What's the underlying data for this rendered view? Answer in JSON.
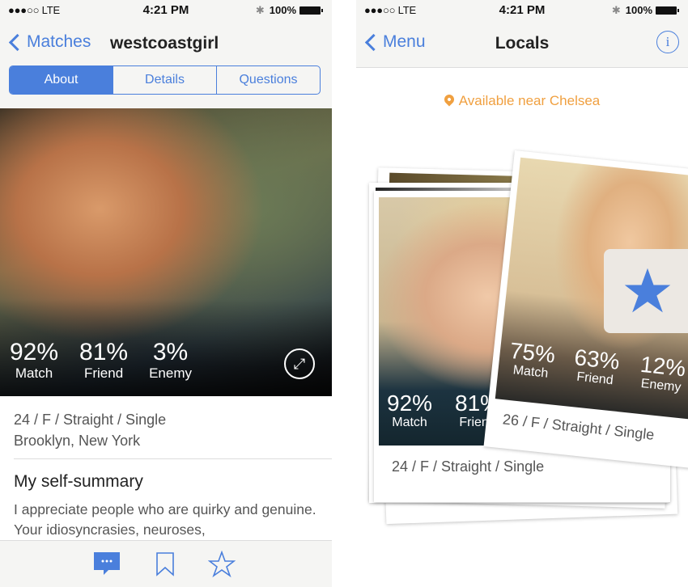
{
  "status_bar": {
    "signal": "●●●○○ LTE",
    "time": "4:21 PM",
    "battery": "100%"
  },
  "left_screen": {
    "nav": {
      "back_label": "Matches",
      "title": "westcoastgirl"
    },
    "segments": [
      {
        "label": "About",
        "active": true
      },
      {
        "label": "Details",
        "active": false
      },
      {
        "label": "Questions",
        "active": false
      }
    ],
    "stats": [
      {
        "value": "92%",
        "label": "Match"
      },
      {
        "value": "81%",
        "label": "Friend"
      },
      {
        "value": "3%",
        "label": "Enemy"
      }
    ],
    "profile_line": "24 / F / Straight / Single",
    "location": "Brooklyn, New York",
    "summary_title": "My self-summary",
    "summary_text": "I appreciate people who are quirky and genuine. Your idiosyncrasies, neuroses,",
    "tabbar": {
      "icons": [
        "message-icon",
        "bookmark-icon",
        "star-icon"
      ]
    }
  },
  "right_screen": {
    "nav": {
      "back_label": "Menu",
      "title": "Locals"
    },
    "location_text": "Available near Chelsea",
    "front_card": {
      "stats": [
        {
          "value": "92%",
          "label": "Match"
        },
        {
          "value": "81%",
          "label": "Friend"
        }
      ],
      "profile_line": "24 / F / Straight / Single"
    },
    "tilted_card": {
      "stats": [
        {
          "value": "75%",
          "label": "Match"
        },
        {
          "value": "63%",
          "label": "Friend"
        },
        {
          "value": "12%",
          "label": "Enemy"
        }
      ],
      "profile_line": "26 / F / Straight / Single"
    }
  },
  "colors": {
    "accent": "#4a7fdc",
    "location": "#f0a040",
    "bar_bg": "#f5f5f3"
  }
}
